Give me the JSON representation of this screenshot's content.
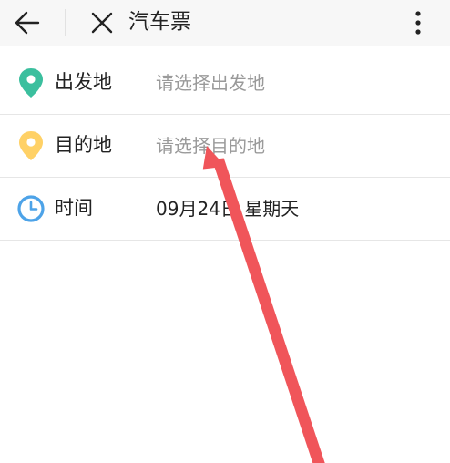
{
  "header": {
    "back_icon": "arrow-left-icon",
    "close_icon": "close-icon",
    "title": "汽车票",
    "more_icon": "more-vertical-icon"
  },
  "form": {
    "rows": [
      {
        "icon": "location-pin-icon",
        "icon_color": "#3bbf9e",
        "label": "出发地",
        "value": "请选择出发地",
        "is_placeholder": true
      },
      {
        "icon": "location-pin-icon",
        "icon_color": "#ffd166",
        "label": "目的地",
        "value": "请选择目的地",
        "is_placeholder": true
      },
      {
        "icon": "clock-icon",
        "icon_color": "#4da3e8",
        "label": "时间",
        "value": "09月24日 星期天",
        "is_placeholder": false
      }
    ]
  },
  "annotation": {
    "type": "red-arrow",
    "color": "#f0555a"
  },
  "colors": {
    "header_background": "#f7f7f7",
    "divider": "#e6e6e6",
    "placeholder_text": "#9a9a9a",
    "text": "#222222"
  }
}
